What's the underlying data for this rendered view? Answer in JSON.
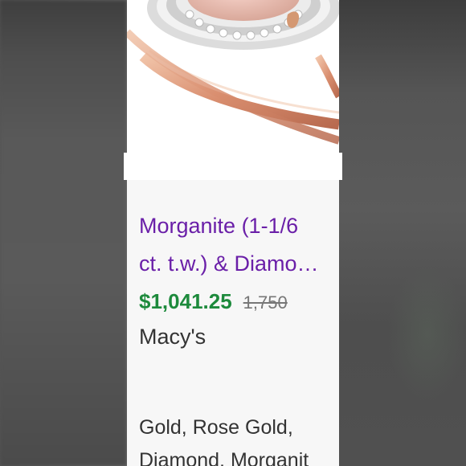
{
  "product": {
    "title_line1": "Morganite (1-1/6",
    "title_line2": "ct. t.w.) & Diamo…",
    "price": "$1,041.25",
    "original_price": "1,750",
    "store": "Macy's",
    "tags_line1": "Gold, Rose Gold,",
    "tags_line2": "Diamond, Morganit"
  },
  "colors": {
    "title": "#6a1fa8",
    "price": "#1d8a3c",
    "card_background": "#f7f7f7"
  }
}
